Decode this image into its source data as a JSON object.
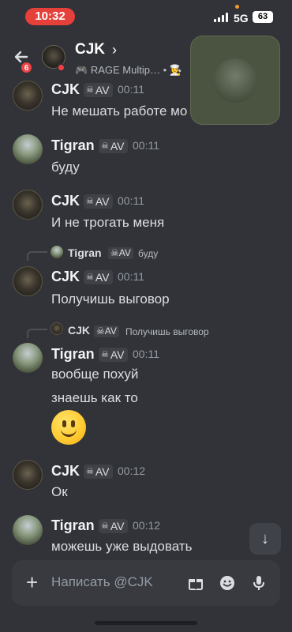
{
  "status_bar": {
    "time": "10:32",
    "network": "5G",
    "battery": "63"
  },
  "header": {
    "back_badge": "6",
    "title": "CJK",
    "chevron": "›",
    "activity": "RAGE Multip…",
    "activity_extra": "• 🧑‍🍳"
  },
  "messages": [
    {
      "author": "CJK",
      "tag": "AV",
      "time": "00:11",
      "lines": [
        "Не мешать работе мо"
      ]
    },
    {
      "author": "Tigran",
      "tag": "AV",
      "time": "00:11",
      "lines": [
        "буду"
      ]
    },
    {
      "author": "CJK",
      "tag": "AV",
      "time": "00:11",
      "lines": [
        "И не трогать меня"
      ]
    },
    {
      "reply": {
        "author": "Tigran",
        "tag": "AV",
        "text": "буду"
      },
      "author": "CJK",
      "tag": "AV",
      "time": "00:11",
      "lines": [
        "Получишь выговор"
      ]
    },
    {
      "reply": {
        "author": "CJK",
        "tag": "AV",
        "text": "Получишь выговор"
      },
      "author": "Tigran",
      "tag": "AV",
      "time": "00:11",
      "lines": [
        "вообще похуй",
        "знаешь как то"
      ],
      "emoji": "slightly-smiling-face"
    },
    {
      "author": "CJK",
      "tag": "AV",
      "time": "00:12",
      "lines": [
        "Ок"
      ]
    },
    {
      "author": "Tigran",
      "tag": "AV",
      "time": "00:12",
      "lines": [
        "можешь уже выдовать"
      ]
    }
  ],
  "composer": {
    "placeholder": "Написать @CJK"
  },
  "icons": [
    "back-arrow-icon",
    "chevron-right-icon",
    "gamepad-icon",
    "skull-icon",
    "scroll-down-icon",
    "plus-icon",
    "gift-icon",
    "emoji-icon",
    "microphone-icon"
  ],
  "colors": {
    "background": "#313338",
    "dnd": "#f23f43",
    "badge": "#ed4245",
    "time_pill": "#e5403a"
  }
}
